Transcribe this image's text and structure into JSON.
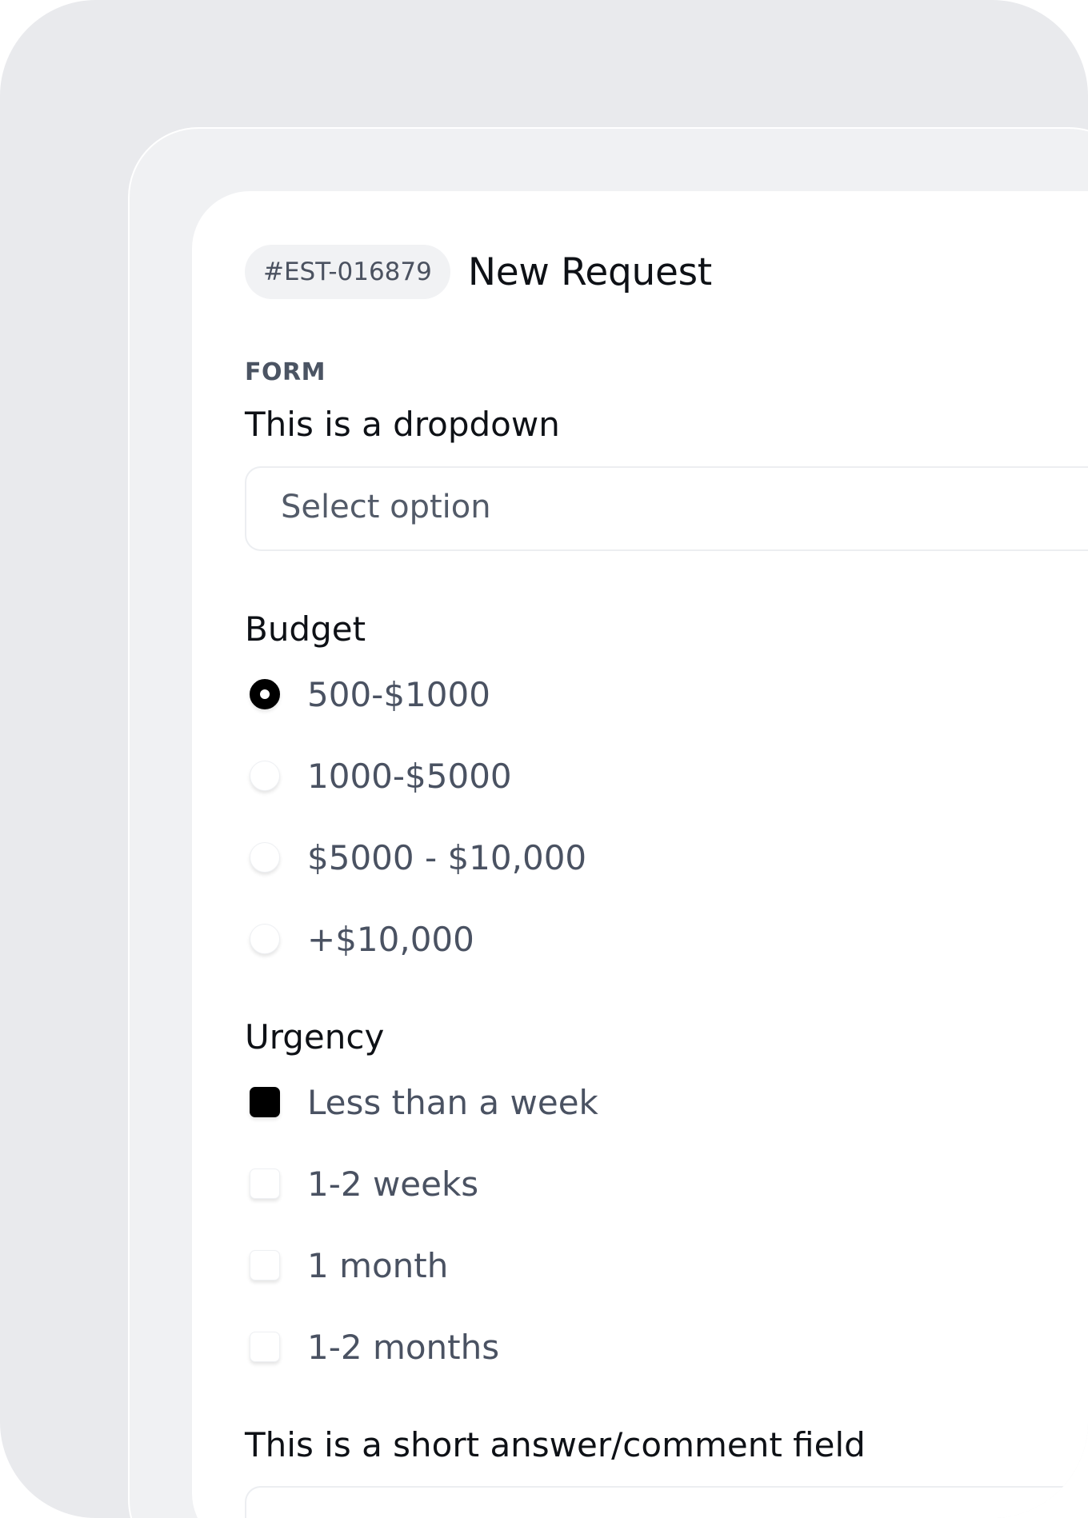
{
  "header": {
    "ticket_id": "#EST-016879",
    "title": "New Request"
  },
  "form": {
    "section_label": "FORM",
    "dropdown": {
      "label": "This is a dropdown",
      "placeholder": "Select option"
    },
    "budget": {
      "label": "Budget",
      "options": [
        {
          "label": "500-$1000",
          "selected": true
        },
        {
          "label": "1000-$5000",
          "selected": false
        },
        {
          "label": "$5000 - $10,000",
          "selected": false
        },
        {
          "label": "+$10,000",
          "selected": false
        }
      ]
    },
    "urgency": {
      "label": "Urgency",
      "options": [
        {
          "label": "Less than a week",
          "checked": true
        },
        {
          "label": "1-2 weeks",
          "checked": false
        },
        {
          "label": "1 month",
          "checked": false
        },
        {
          "label": "1-2 months",
          "checked": false
        }
      ]
    },
    "comment": {
      "label": "This is a short answer/comment field",
      "placeholder": ""
    }
  },
  "colors": {
    "background": "#e9eaed",
    "card": "#ffffff",
    "accent": "#000000",
    "text_primary": "#0e1116",
    "text_secondary": "#4a5262"
  }
}
